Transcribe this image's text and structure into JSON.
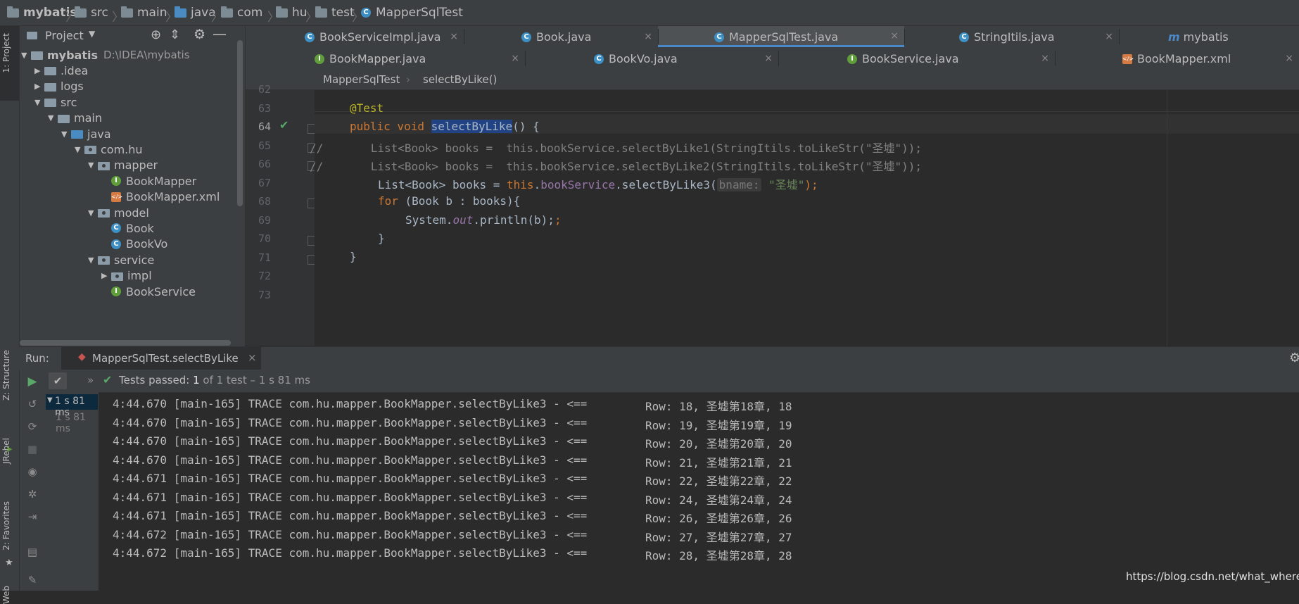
{
  "breadcrumb": [
    "mybatis",
    "src",
    "main",
    "java",
    "com",
    "hu",
    "test",
    "MapperSqlTest"
  ],
  "left_strip": {
    "project_tab": "1: Project",
    "structure_tab": "Z: Structure",
    "jrebel_tab": "JRebel",
    "favorites_tab": "2: Favorites",
    "web_tab": "Web"
  },
  "project_panel": {
    "title": "Project",
    "tree": [
      {
        "label": "mybatis",
        "extra": "D:\\IDEA\\mybatis",
        "kind": "module",
        "indent": 0,
        "open": true
      },
      {
        "label": ".idea",
        "kind": "folder",
        "indent": 1,
        "open": false
      },
      {
        "label": "logs",
        "kind": "folder",
        "indent": 1,
        "open": false
      },
      {
        "label": "src",
        "kind": "folder",
        "indent": 1,
        "open": true
      },
      {
        "label": "main",
        "kind": "folder",
        "indent": 2,
        "open": true
      },
      {
        "label": "java",
        "kind": "srcfolder",
        "indent": 3,
        "open": true
      },
      {
        "label": "com.hu",
        "kind": "package",
        "indent": 4,
        "open": true
      },
      {
        "label": "mapper",
        "kind": "package",
        "indent": 5,
        "open": true
      },
      {
        "label": "BookMapper",
        "kind": "interface",
        "indent": 6
      },
      {
        "label": "BookMapper.xml",
        "kind": "xml",
        "indent": 6
      },
      {
        "label": "model",
        "kind": "package",
        "indent": 5,
        "open": true
      },
      {
        "label": "Book",
        "kind": "class",
        "indent": 6
      },
      {
        "label": "BookVo",
        "kind": "class",
        "indent": 6
      },
      {
        "label": "service",
        "kind": "package",
        "indent": 5,
        "open": true
      },
      {
        "label": "impl",
        "kind": "package",
        "indent": 6,
        "open": false
      },
      {
        "label": "BookService",
        "kind": "interface",
        "indent": 6
      }
    ]
  },
  "tabs_row1": [
    {
      "label": "BookServiceImpl.java",
      "kind": "class",
      "active": false
    },
    {
      "label": "Book.java",
      "kind": "class",
      "active": false
    },
    {
      "label": "MapperSqlTest.java",
      "kind": "class",
      "active": true
    },
    {
      "label": "StringItils.java",
      "kind": "class",
      "active": false
    },
    {
      "label": "mybatis",
      "kind": "module",
      "active": false
    }
  ],
  "tabs_row2": [
    {
      "label": "BookMapper.java",
      "kind": "interface"
    },
    {
      "label": "BookVo.java",
      "kind": "class"
    },
    {
      "label": "BookService.java",
      "kind": "interface"
    },
    {
      "label": "BookMapper.xml",
      "kind": "xml"
    }
  ],
  "editor_breadcrumb": [
    "MapperSqlTest",
    "selectByLike()"
  ],
  "line_numbers": [
    "62",
    "63",
    "64",
    "65",
    "66",
    "67",
    "68",
    "69",
    "70",
    "71",
    "72",
    "73"
  ],
  "code": {
    "l63": "@Test",
    "l64_kw": "public void ",
    "l64_name": "selectByLike",
    "l64_rest": "() {",
    "l65": "//       List<Book> books =  this.bookService.selectByLike1(StringItils.toLikeStr(\"圣墟\"));",
    "l66": "//       List<Book> books =  this.bookService.selectByLike2(StringItils.toLikeStr(\"圣墟\"));",
    "l67_a": "List<Book> books = ",
    "l67_this": "this",
    "l67_dot": ".",
    "l67_field": "bookService",
    "l67_call": ".selectByLike3(",
    "l67_hint": "bname:",
    "l67_str": "\"圣墟\"",
    "l67_end": ");",
    "l68_kw": "for",
    "l68_rest": " (Book b : books){",
    "l69_a": "System.",
    "l69_out": "out",
    "l69_b": ".println(b);",
    "l70": "}",
    "l71": "}"
  },
  "run": {
    "label": "Run:",
    "config": "MapperSqlTest.selectByLike",
    "status_prefix": "Tests passed:",
    "status_count": "1",
    "status_rest": "of 1 test – 1 s 81 ms",
    "tree_time_1": "1 s 81 ms",
    "tree_time_2": "1 s 81 ms",
    "log_prefixes": [
      "4:44.670 [main-165] TRACE com.hu.mapper.BookMapper.selectByLike3 - <==",
      "4:44.670 [main-165] TRACE com.hu.mapper.BookMapper.selectByLike3 - <==",
      "4:44.670 [main-165] TRACE com.hu.mapper.BookMapper.selectByLike3 - <==",
      "4:44.670 [main-165] TRACE com.hu.mapper.BookMapper.selectByLike3 - <==",
      "4:44.671 [main-165] TRACE com.hu.mapper.BookMapper.selectByLike3 - <==",
      "4:44.671 [main-165] TRACE com.hu.mapper.BookMapper.selectByLike3 - <==",
      "4:44.671 [main-165] TRACE com.hu.mapper.BookMapper.selectByLike3 - <==",
      "4:44.672 [main-165] TRACE com.hu.mapper.BookMapper.selectByLike3 - <==",
      "4:44.672 [main-165] TRACE com.hu.mapper.BookMapper.selectByLike3 - <=="
    ],
    "log_rows": [
      "Row: 18, 圣墟第18章, 18",
      "Row: 19, 圣墟第19章, 19",
      "Row: 20, 圣墟第20章, 20",
      "Row: 21, 圣墟第21章, 21",
      "Row: 22, 圣墟第22章, 22",
      "Row: 24, 圣墟第24章, 24",
      "Row: 26, 圣墟第26章, 26",
      "Row: 27, 圣墟第27章, 27",
      "Row: 28, 圣墟第28章, 28"
    ]
  },
  "watermark": "https://blog.csdn.net/what_where"
}
